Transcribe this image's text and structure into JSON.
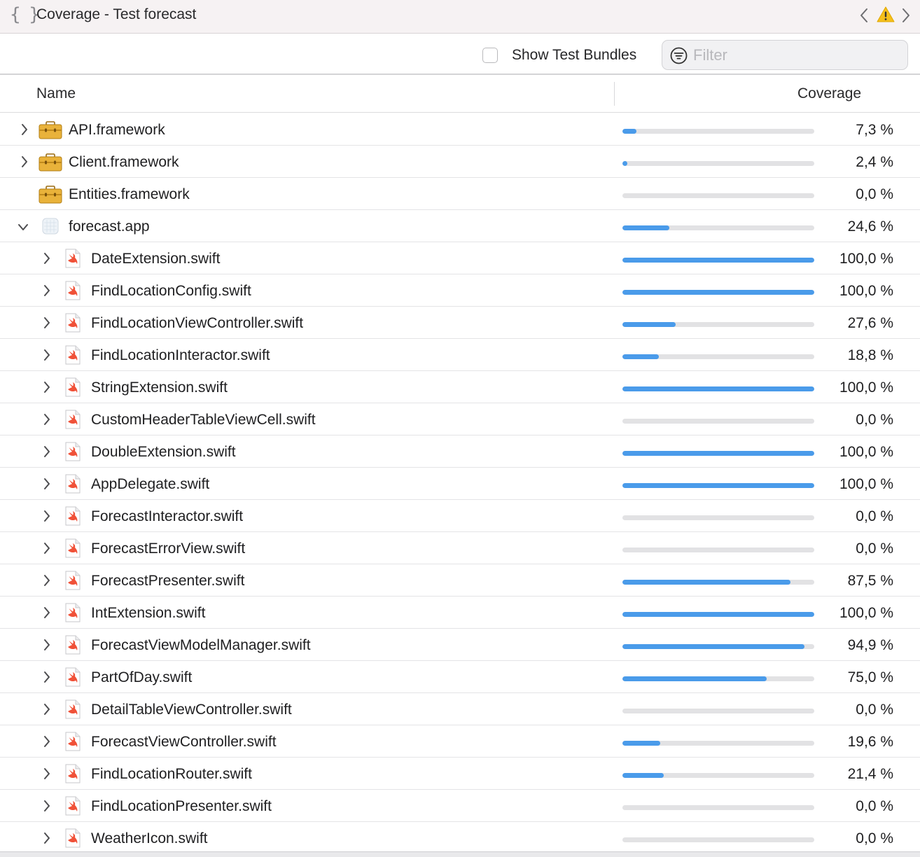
{
  "window": {
    "title": "Coverage - Test forecast",
    "braces_glyph": "{ }",
    "icons": [
      "braces-icon",
      "chevron-left-icon",
      "warning-icon",
      "chevron-right-icon"
    ]
  },
  "toolbar": {
    "show_test_bundles_label": "Show Test Bundles",
    "show_test_bundles_checked": false,
    "filter_placeholder": "Filter",
    "filter_value": ""
  },
  "table": {
    "columns": [
      "Name",
      "Coverage"
    ],
    "accent_color": "#4a9bea",
    "rows": [
      {
        "name": "API.framework",
        "kind": "framework",
        "level": 0,
        "expander": "collapsed",
        "coverage": 7.3,
        "coverage_label": "7,3 %"
      },
      {
        "name": "Client.framework",
        "kind": "framework",
        "level": 0,
        "expander": "collapsed",
        "coverage": 2.4,
        "coverage_label": "2,4 %"
      },
      {
        "name": "Entities.framework",
        "kind": "framework",
        "level": 0,
        "expander": "none",
        "coverage": 0.0,
        "coverage_label": "0,0 %"
      },
      {
        "name": "forecast.app",
        "kind": "app",
        "level": 0,
        "expander": "expanded",
        "coverage": 24.6,
        "coverage_label": "24,6 %"
      },
      {
        "name": "DateExtension.swift",
        "kind": "swift",
        "level": 1,
        "expander": "collapsed",
        "coverage": 100.0,
        "coverage_label": "100,0 %"
      },
      {
        "name": "FindLocationConfig.swift",
        "kind": "swift",
        "level": 1,
        "expander": "collapsed",
        "coverage": 100.0,
        "coverage_label": "100,0 %"
      },
      {
        "name": "FindLocationViewController.swift",
        "kind": "swift",
        "level": 1,
        "expander": "collapsed",
        "coverage": 27.6,
        "coverage_label": "27,6 %"
      },
      {
        "name": "FindLocationInteractor.swift",
        "kind": "swift",
        "level": 1,
        "expander": "collapsed",
        "coverage": 18.8,
        "coverage_label": "18,8 %"
      },
      {
        "name": "StringExtension.swift",
        "kind": "swift",
        "level": 1,
        "expander": "collapsed",
        "coverage": 100.0,
        "coverage_label": "100,0 %"
      },
      {
        "name": "CustomHeaderTableViewCell.swift",
        "kind": "swift",
        "level": 1,
        "expander": "collapsed",
        "coverage": 0.0,
        "coverage_label": "0,0 %"
      },
      {
        "name": "DoubleExtension.swift",
        "kind": "swift",
        "level": 1,
        "expander": "collapsed",
        "coverage": 100.0,
        "coverage_label": "100,0 %"
      },
      {
        "name": "AppDelegate.swift",
        "kind": "swift",
        "level": 1,
        "expander": "collapsed",
        "coverage": 100.0,
        "coverage_label": "100,0 %"
      },
      {
        "name": "ForecastInteractor.swift",
        "kind": "swift",
        "level": 1,
        "expander": "collapsed",
        "coverage": 0.0,
        "coverage_label": "0,0 %"
      },
      {
        "name": "ForecastErrorView.swift",
        "kind": "swift",
        "level": 1,
        "expander": "collapsed",
        "coverage": 0.0,
        "coverage_label": "0,0 %"
      },
      {
        "name": "ForecastPresenter.swift",
        "kind": "swift",
        "level": 1,
        "expander": "collapsed",
        "coverage": 87.5,
        "coverage_label": "87,5 %"
      },
      {
        "name": "IntExtension.swift",
        "kind": "swift",
        "level": 1,
        "expander": "collapsed",
        "coverage": 100.0,
        "coverage_label": "100,0 %"
      },
      {
        "name": "ForecastViewModelManager.swift",
        "kind": "swift",
        "level": 1,
        "expander": "collapsed",
        "coverage": 94.9,
        "coverage_label": "94,9 %"
      },
      {
        "name": "PartOfDay.swift",
        "kind": "swift",
        "level": 1,
        "expander": "collapsed",
        "coverage": 75.0,
        "coverage_label": "75,0 %"
      },
      {
        "name": "DetailTableViewController.swift",
        "kind": "swift",
        "level": 1,
        "expander": "collapsed",
        "coverage": 0.0,
        "coverage_label": "0,0 %"
      },
      {
        "name": "ForecastViewController.swift",
        "kind": "swift",
        "level": 1,
        "expander": "collapsed",
        "coverage": 19.6,
        "coverage_label": "19,6 %"
      },
      {
        "name": "FindLocationRouter.swift",
        "kind": "swift",
        "level": 1,
        "expander": "collapsed",
        "coverage": 21.4,
        "coverage_label": "21,4 %"
      },
      {
        "name": "FindLocationPresenter.swift",
        "kind": "swift",
        "level": 1,
        "expander": "collapsed",
        "coverage": 0.0,
        "coverage_label": "0,0 %"
      },
      {
        "name": "WeatherIcon.swift",
        "kind": "swift",
        "level": 1,
        "expander": "collapsed",
        "coverage": 0.0,
        "coverage_label": "0,0 %"
      }
    ]
  }
}
